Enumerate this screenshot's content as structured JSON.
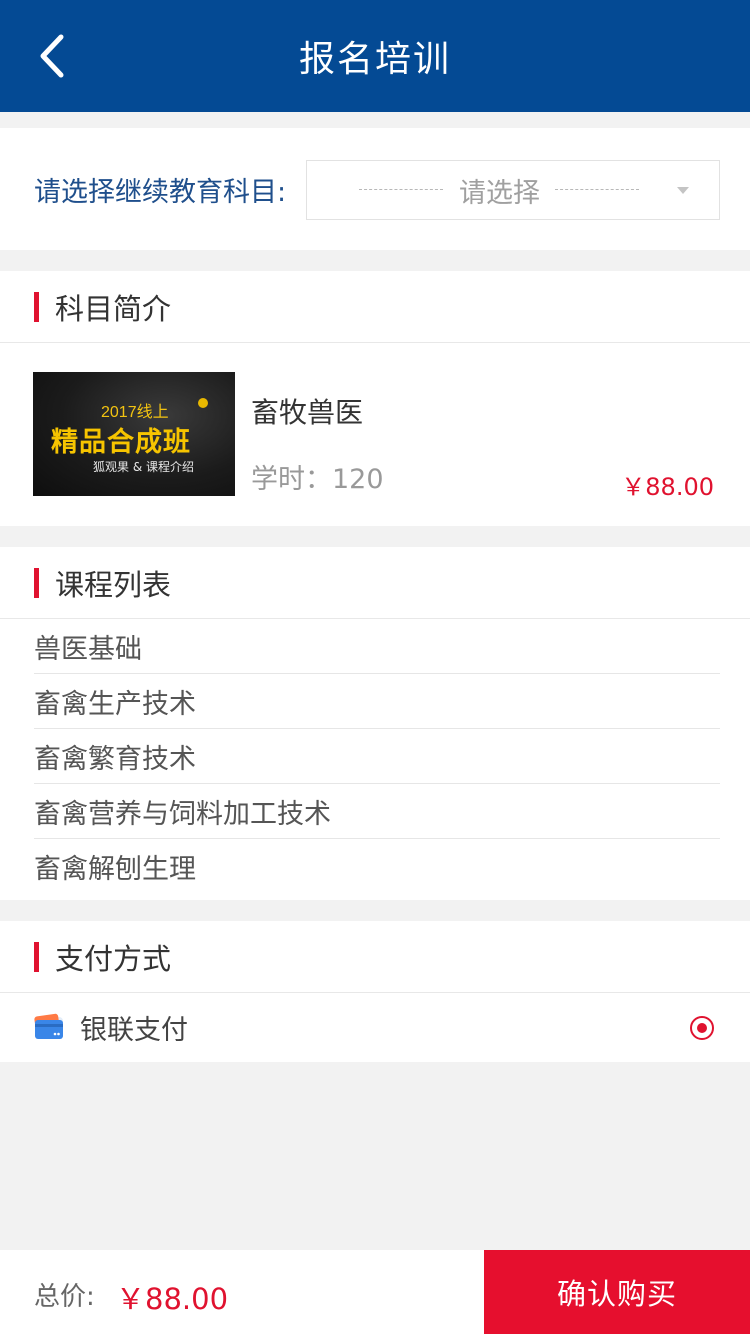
{
  "navbar": {
    "title": "报名培训",
    "back_icon": "chevron-left-icon",
    "bg_color": "#044a94"
  },
  "subject_select": {
    "label": "请选择继续教育科目:",
    "placeholder": "请选择"
  },
  "intro": {
    "section_title": "科目简介",
    "thumbnail_text": {
      "year": "2017线上",
      "main": "精品合成班",
      "sub": "狐观果 & 课程介绍"
    },
    "name": "畜牧兽医",
    "hours_label": "学时：120",
    "price": "￥88.00"
  },
  "courses": {
    "section_title": "课程列表",
    "items": [
      {
        "label": "兽医基础"
      },
      {
        "label": "畜禽生产技术"
      },
      {
        "label": "畜禽繁育技术"
      },
      {
        "label": "畜禽营养与饲料加工技术"
      },
      {
        "label": "畜禽解刨生理"
      }
    ]
  },
  "payment": {
    "section_title": "支付方式",
    "methods": [
      {
        "label": "银联支付",
        "icon": "card-icon",
        "selected": true
      }
    ]
  },
  "bottom": {
    "total_label": "总价:",
    "total_price": "￥88.00",
    "buy_label": "确认购买"
  },
  "colors": {
    "accent_red": "#e0122f",
    "label_blue": "#1f4f8c"
  }
}
